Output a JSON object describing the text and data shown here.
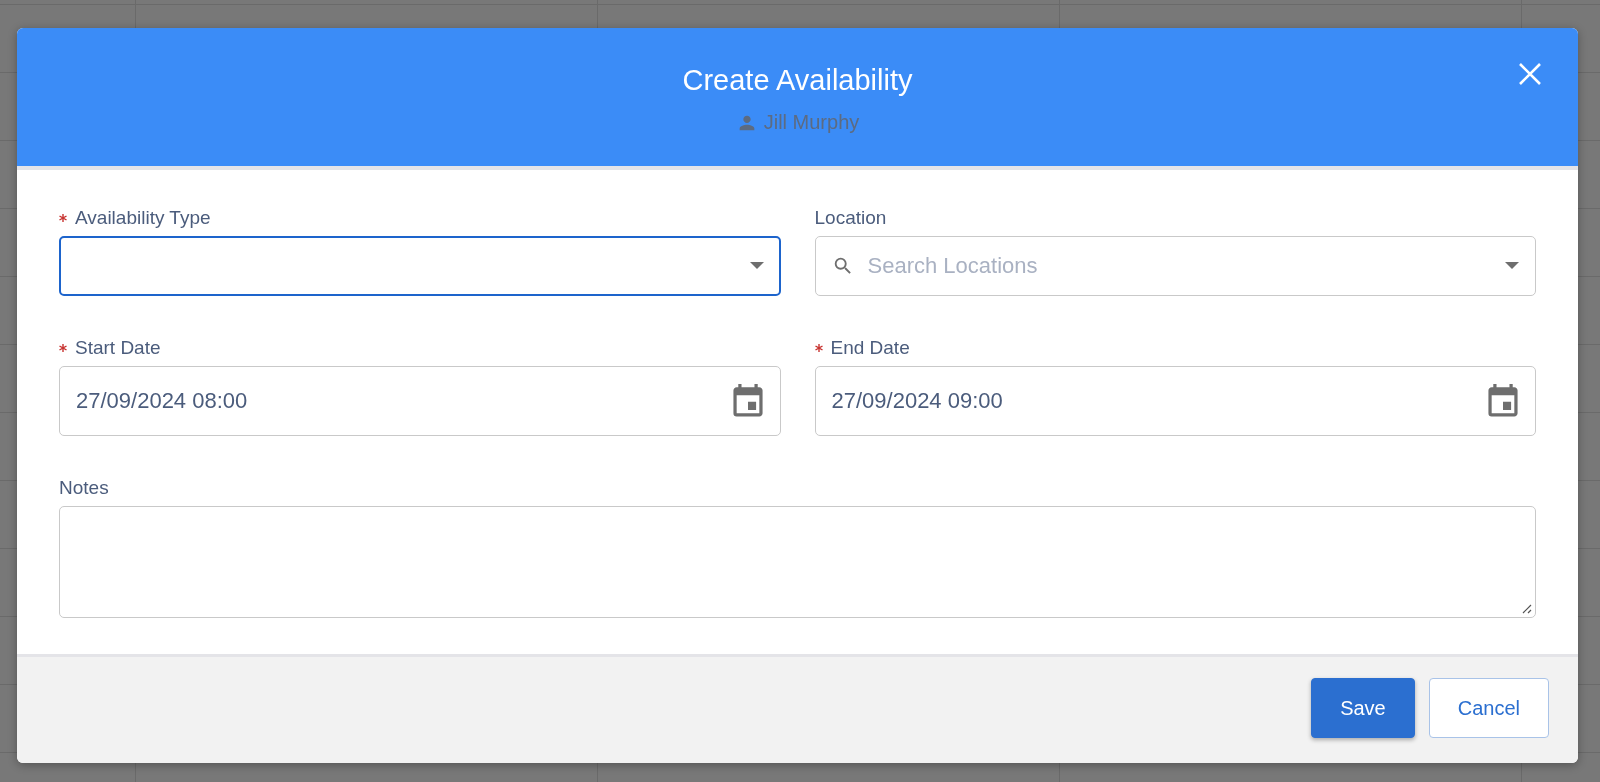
{
  "dialog": {
    "title": "Create Availability",
    "subtitle": "Jill Murphy",
    "fields": [
      {
        "kind": "select",
        "label": "Availability Type",
        "required": true,
        "focused": true
      },
      {
        "kind": "search-select",
        "label": "Location",
        "required": false,
        "focused": false,
        "placeholder": "Search Locations"
      },
      {
        "kind": "date",
        "label": "Start Date",
        "required": true,
        "focused": false,
        "value": "27/09/2024 08:00"
      },
      {
        "kind": "date",
        "label": "End Date",
        "required": true,
        "focused": false,
        "value": "27/09/2024 09:00"
      },
      {
        "kind": "textarea",
        "label": "Notes",
        "required": false,
        "focused": false
      }
    ],
    "buttons": [
      {
        "label": "Save",
        "kind": "primary"
      },
      {
        "label": "Cancel",
        "kind": "secondary"
      }
    ]
  }
}
